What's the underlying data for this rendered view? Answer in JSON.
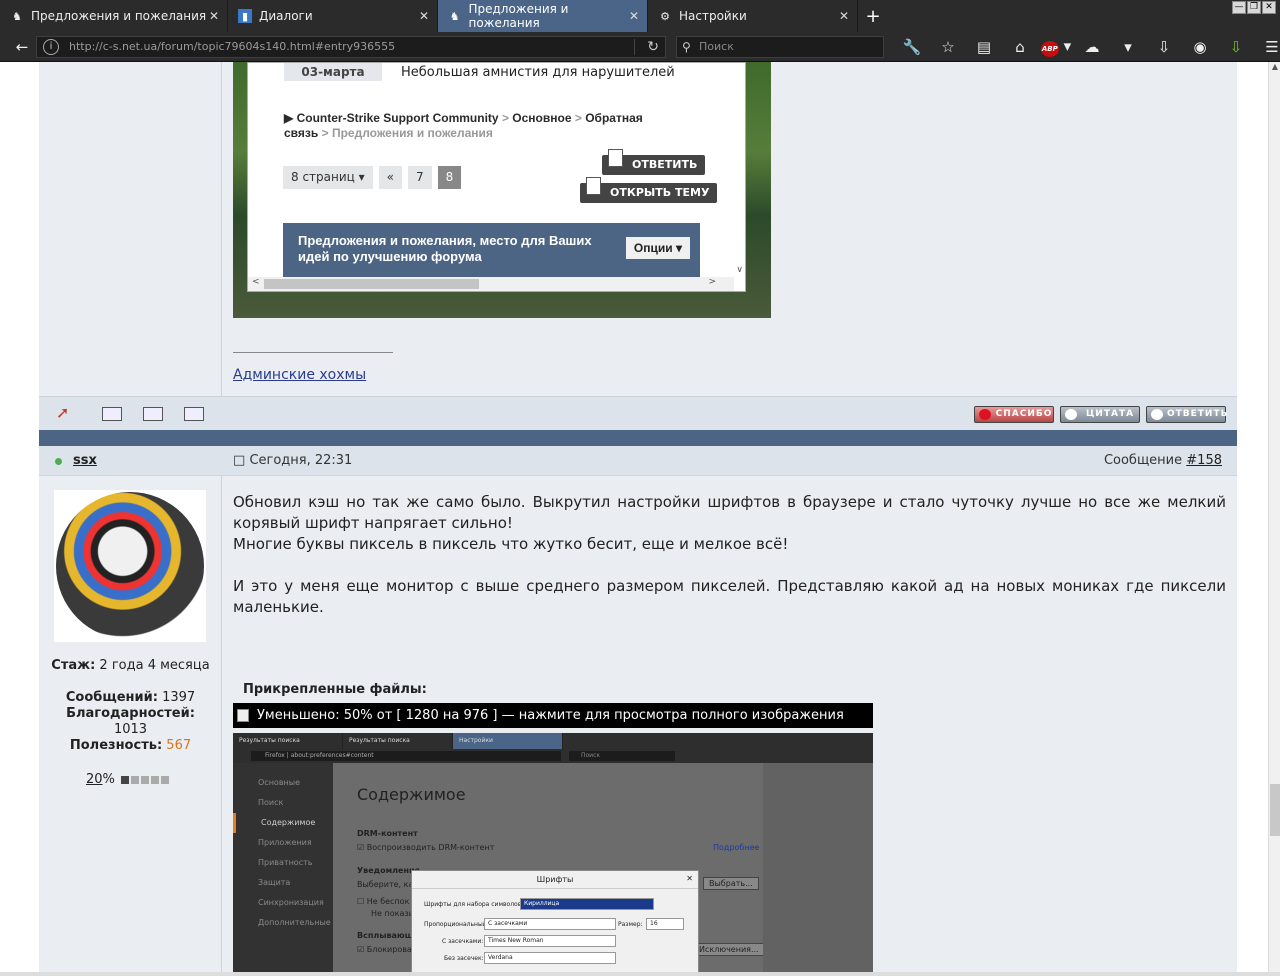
{
  "browser": {
    "tabs": [
      {
        "title": "Предложения и пожелания",
        "active": false,
        "icon": "forum-favicon"
      },
      {
        "title": "Диалоги",
        "active": false,
        "icon": "chat-favicon"
      },
      {
        "title": "Предложения и пожелания",
        "active": true,
        "icon": "forum-favicon"
      },
      {
        "title": "Настройки",
        "active": false,
        "icon": "gear-icon"
      }
    ],
    "new_tab": "+",
    "url": "http://c-s.net.ua/forum/topic79604s140.html#entry936555",
    "search_placeholder": "Поиск",
    "toolbar_icons": [
      "wrench-icon",
      "star-icon",
      "reader-icon",
      "home-icon",
      "adblock-icon",
      "cloud-icon",
      "menu-dropdown-icon",
      "download-icon",
      "mask-icon",
      "download-green-icon",
      "hamburger-icon"
    ],
    "abp_label": "ABP"
  },
  "prev_post": {
    "screenshot": {
      "date": "03-марта",
      "news": "Небольшая амнистия для нарушителей",
      "breadcrumb_1": "Counter-Strike Support Community",
      "breadcrumb_sep": ">",
      "breadcrumb_2": "Основное",
      "breadcrumb_3": "Обратная связь",
      "breadcrumb_4": "Предложения и пожелания",
      "pages_label": "8 страниц ▾",
      "page_prev": "«",
      "page_7": "7",
      "page_8": "8",
      "reply_btn": "ОТВЕТИТЬ",
      "open_topic_btn": "ОТКРЫТЬ ТЕМУ",
      "forum_desc": "Предложения и пожелания, место для Ваших идей по улучшению форума",
      "options_btn": "Опции ▾"
    },
    "signature": "Админские хохмы"
  },
  "actions": {
    "thanks": "СПАСИБО",
    "quote": "ЦИТАТА",
    "reply": "ОТВЕТИТЬ"
  },
  "post": {
    "username": "ssx",
    "time": "Сегодня, 22:31",
    "msg_label": "Сообщение",
    "msg_number": "#158",
    "user_stats": {
      "tenure_label": "Стаж:",
      "tenure": "2 года 4 месяца",
      "posts_label": "Сообщений:",
      "posts": "1397",
      "thanks_label": "Благодарностей:",
      "thanks": "1013",
      "usefulness_label": "Полезность:",
      "usefulness": "567",
      "warn_percent": "20",
      "warn_suffix": "%",
      "warn_level": 1,
      "warn_max": 5
    },
    "text_p1": "Обновил кэш но так же само было. Выкрутил настройки шрифтов в браузере и стало чуточку лучше но все же мелкий корявый шрифт напрягает сильно!",
    "text_p2": "Многие буквы пиксель в пиксель что жутко бесит, еще и мелкое всё!",
    "text_p3": "И это у меня еще монитор с выше среднего размером пикселей. Представляю какой ад на новых мониках где пиксели маленькие.",
    "attachments_title": "Прикрепленные файлы:",
    "attachment_caption": "Уменьшено: 50% от [ 1280 на 976 ] — нажмите для просмотра полного изображения",
    "attachment_preview": {
      "tabs": [
        "Результаты поиска",
        "Результаты поиска",
        "Настройки"
      ],
      "url": "about:preferences#content",
      "url_prefix": "Firefox",
      "search": "Поиск",
      "sidebar": [
        "Основные",
        "Поиск",
        "Содержимое",
        "Приложения",
        "Приватность",
        "Защита",
        "Синхронизация",
        "Дополнительные"
      ],
      "heading": "Содержимое",
      "drm_title": "DRM-контент",
      "drm_check": "Воспроизводить DRM-контент",
      "more_link": "Подробнее",
      "notif_title": "Уведомления",
      "notif_text": "Выберите, как",
      "choose_btn": "Выбрать...",
      "dnd_1": "Не беспок",
      "dnd_2": "Не показы",
      "popups_title": "Всплывающ",
      "block_label": "Блокирова",
      "exceptions_btn": "Исключения...",
      "dialog_title": "Шрифты",
      "fonts_for": "Шрифты для набора символов:",
      "charset": "Кириллица",
      "proportional": "Пропорциональный:",
      "prop_val": "С засечками",
      "size_label": "Размер:",
      "size_val": "16",
      "serif_label": "С засечками:",
      "serif_val": "Times New Roman",
      "sans_label": "Без засечек:",
      "sans_val": "Verdana"
    }
  },
  "colors": {
    "accent": "#4d6584",
    "link": "#2c3c8c",
    "usefulness": "#d8761b"
  }
}
